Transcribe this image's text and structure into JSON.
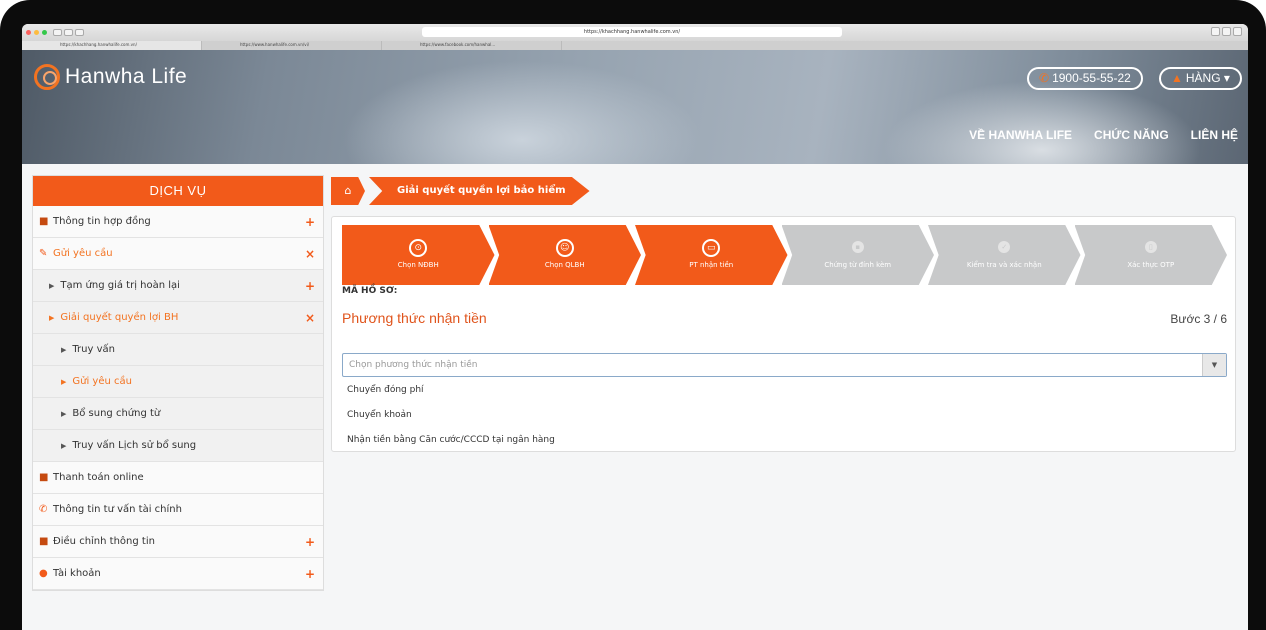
{
  "browser": {
    "url": "https://khachhang.hanwhalife.com.vn/",
    "tabs": [
      "https://khachhang.hanwhalife.com.vn/",
      "https://www.hanwhalife.com.vn/vi/",
      "https://www.facebook.com/hanwhal..."
    ]
  },
  "header": {
    "logo_text": "Hanwha Life",
    "hotline": "1900-55-55-22",
    "user_menu": "HÀNG",
    "nav": [
      "VỀ HANWHA LIFE",
      "CHỨC NĂNG",
      "LIÊN HỆ"
    ]
  },
  "sidebar": {
    "title": "DỊCH VỤ",
    "items": [
      {
        "label": "Thông tin hợp đồng",
        "sign": "+"
      },
      {
        "label": "Gửi yêu cầu",
        "sign": "×"
      },
      {
        "label": "Tạm ứng giá trị hoàn lại",
        "sign": "+"
      },
      {
        "label": "Giải quyết quyền lợi BH",
        "sign": "×"
      },
      {
        "label": "Truy vấn"
      },
      {
        "label": "Gửi yêu cầu"
      },
      {
        "label": "Bổ sung chứng từ"
      },
      {
        "label": "Truy vấn Lịch sử bổ sung"
      },
      {
        "label": "Thanh toán online"
      },
      {
        "label": "Thông tin tư vấn tài chính"
      },
      {
        "label": "Điều chỉnh thông tin",
        "sign": "+"
      },
      {
        "label": "Tài khoản",
        "sign": "+"
      }
    ]
  },
  "breadcrumb": {
    "current": "Giải quyết quyền lợi bảo hiểm"
  },
  "steps": [
    {
      "label": "Chọn NĐBH",
      "state": "done"
    },
    {
      "label": "Chọn QLBH",
      "state": "done"
    },
    {
      "label": "PT nhận tiền",
      "state": "current"
    },
    {
      "label": "Chứng từ đính kèm",
      "state": "pending"
    },
    {
      "label": "Kiểm tra và xác nhận",
      "state": "pending"
    },
    {
      "label": "Xác thực OTP",
      "state": "pending"
    }
  ],
  "form": {
    "ma_ho_so_label": "MÃ HỒ SƠ:",
    "title": "Phương thức nhận tiền",
    "step_indicator": "Bước 3 / 6",
    "select_placeholder": "Chọn phương thức nhận tiền",
    "options": [
      "Chuyển đóng phí",
      "Chuyển khoản",
      "Nhận tiền bằng Căn cước/CCCD tại ngân hàng"
    ]
  },
  "colors": {
    "accent": "#f25a1a",
    "inactive_step": "#c8c9ca"
  }
}
